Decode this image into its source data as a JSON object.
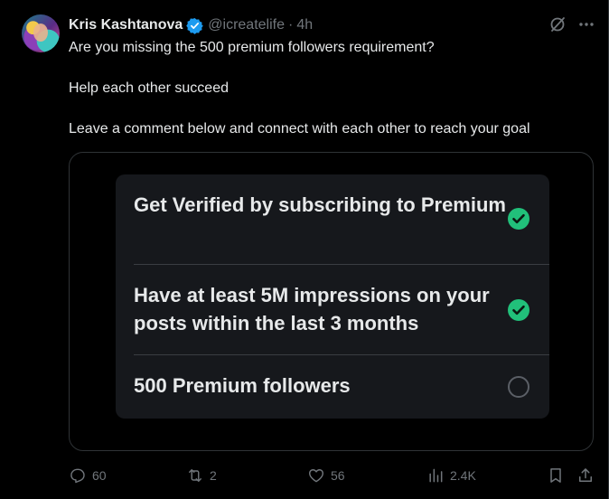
{
  "colors": {
    "background": "#000000",
    "text": "#e7e9ea",
    "muted": "#71767b",
    "verified": "#1d9bf0",
    "check": "#21c07a",
    "card": "#16181c"
  },
  "author": {
    "display_name": "Kris Kashtanova",
    "handle": "@icreatelife",
    "separator": "·",
    "time": "4h"
  },
  "header_icons": [
    "grok-icon",
    "more-icon"
  ],
  "tweet": {
    "line1": "Are you missing the 500 premium followers requirement?",
    "line2": "Help each other succeed",
    "line3": "Leave a comment below and connect with each other to reach your goal"
  },
  "media": {
    "requirements": [
      {
        "text": "Get Verified by subscribing to Premium",
        "done": true
      },
      {
        "text": "Have at least 5M impressions on your posts within the last 3 months",
        "done": true
      },
      {
        "text": "500 Premium followers",
        "done": false
      }
    ]
  },
  "actions": {
    "replies": "60",
    "reposts": "2",
    "likes": "56",
    "views": "2.4K",
    "icons": [
      "reply-icon",
      "repost-icon",
      "like-icon",
      "views-icon",
      "bookmark-icon",
      "share-icon"
    ]
  }
}
